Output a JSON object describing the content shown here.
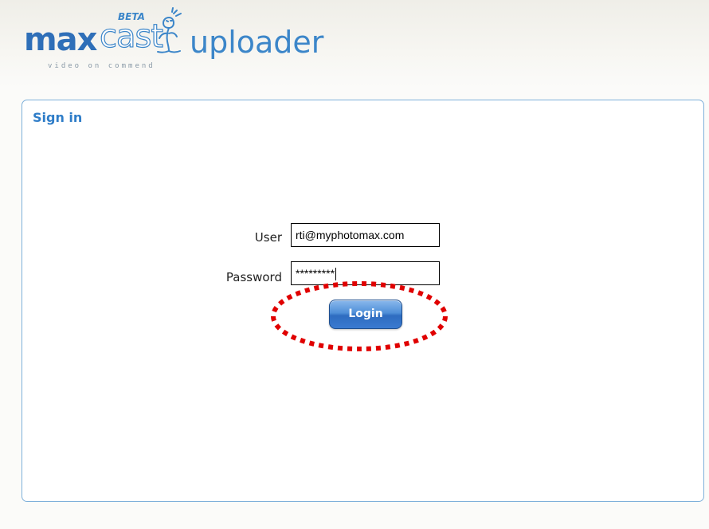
{
  "header": {
    "logo_max": "max",
    "logo_cast": "cast",
    "logo_beta": "BETA",
    "logo_tagline": "video on commend",
    "logo_uploader": "uploader"
  },
  "panel": {
    "title": "Sign in"
  },
  "form": {
    "user_label": "User",
    "user_value": "rti@myphotomax.com",
    "password_label": "Password",
    "password_value": "*********",
    "login_label": "Login"
  },
  "colors": {
    "brand_blue": "#3c86c9",
    "panel_border": "#7eb0da",
    "highlight_ring": "#e00000"
  }
}
